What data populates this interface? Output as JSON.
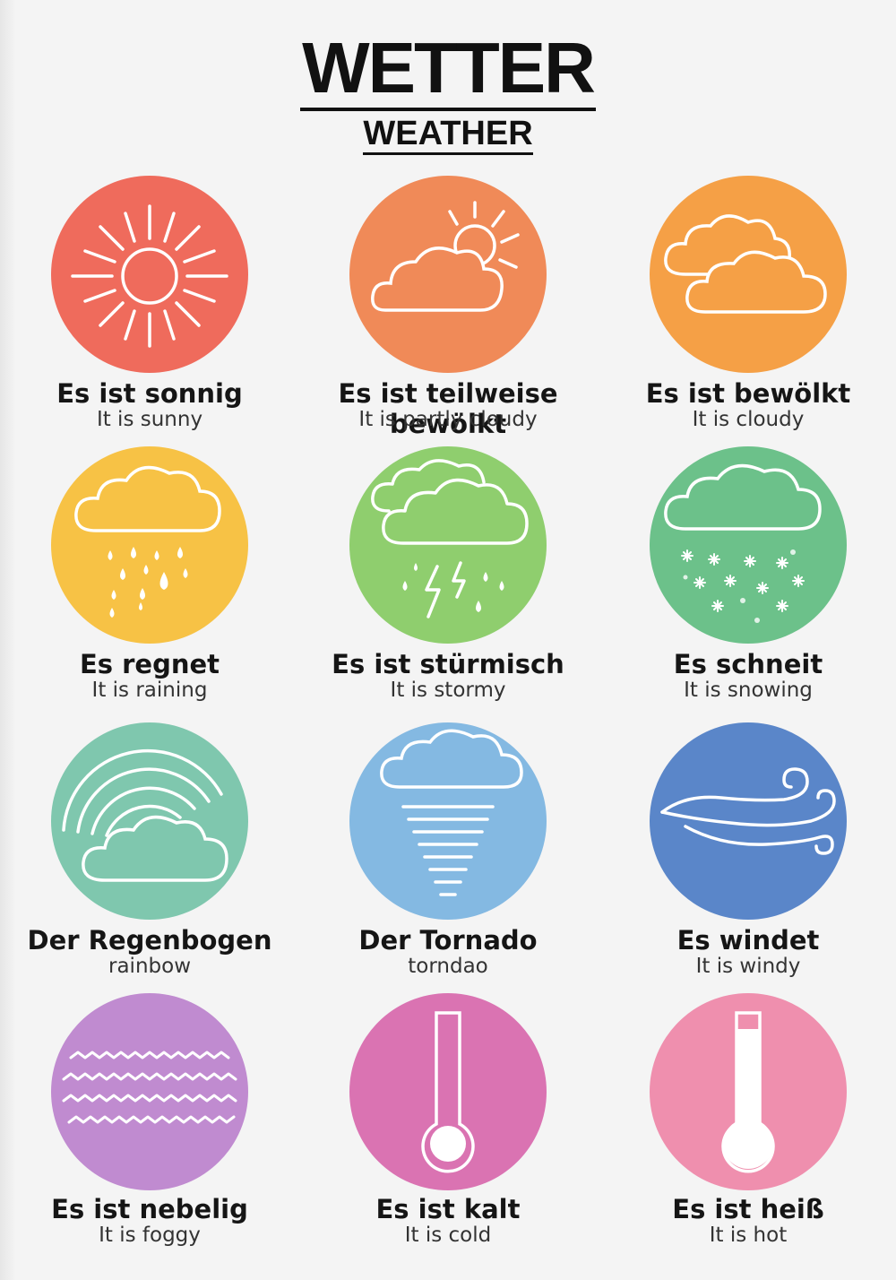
{
  "header": {
    "title": "WETTER",
    "subtitle": "WEATHER"
  },
  "items": [
    {
      "de": "Es ist sonnig",
      "en": "It is sunny",
      "icon": "sun-icon",
      "color": "#ef6b5c"
    },
    {
      "de": "Es ist teilweise bewölkt",
      "en": "It is partly cloudy",
      "icon": "partly-cloudy-icon",
      "color": "#f08a58"
    },
    {
      "de": "Es ist bewölkt",
      "en": "It is cloudy",
      "icon": "cloudy-icon",
      "color": "#f5a046"
    },
    {
      "de": "Es regnet",
      "en": "It is raining",
      "icon": "rain-cloud-icon",
      "color": "#f7c245"
    },
    {
      "de": "Es ist stürmisch",
      "en": "It is stormy",
      "icon": "storm-cloud-icon",
      "color": "#8fce6e"
    },
    {
      "de": "Es schneit",
      "en": "It is snowing",
      "icon": "snow-cloud-icon",
      "color": "#6cc18a"
    },
    {
      "de": "Der Regenbogen",
      "en": "rainbow",
      "icon": "rainbow-cloud-icon",
      "color": "#7fc7ae"
    },
    {
      "de": "Der Tornado",
      "en": "torndao",
      "icon": "tornado-icon",
      "color": "#84b9e2"
    },
    {
      "de": "Es windet",
      "en": "It is windy",
      "icon": "wind-icon",
      "color": "#5a86c9"
    },
    {
      "de": "Es ist nebelig",
      "en": "It is foggy",
      "icon": "fog-icon",
      "color": "#c08bd0"
    },
    {
      "de": "Es ist kalt",
      "en": "It is cold",
      "icon": "thermometer-cold-icon",
      "color": "#da73b2"
    },
    {
      "de": "Es ist heiß",
      "en": "It is hot",
      "icon": "thermometer-hot-icon",
      "color": "#ef8fae"
    }
  ]
}
